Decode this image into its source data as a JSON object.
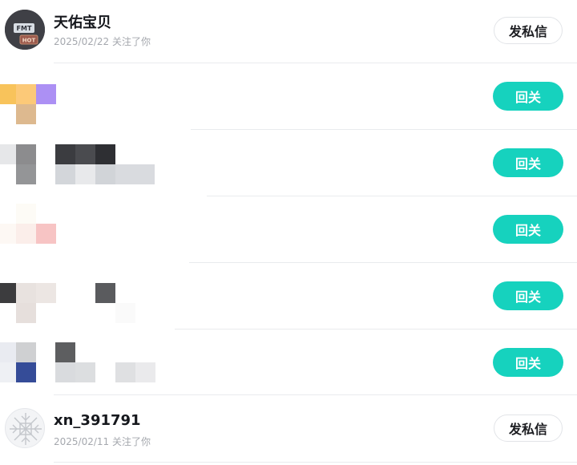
{
  "rows": [
    {
      "name": "天佑宝贝",
      "date": "2025/02/22",
      "action_text": "关注了你",
      "button_label": "发私信",
      "avatar_badge": "FMT",
      "avatar_badge_2": "HOT"
    },
    {
      "button_label": "回关"
    },
    {
      "button_label": "回关"
    },
    {
      "button_label": "回关"
    },
    {
      "button_label": "回关"
    },
    {
      "button_label": "回关"
    },
    {
      "name": "xn_391791",
      "date": "2025/02/11",
      "action_text": "关注了你",
      "button_label": "发私信"
    }
  ],
  "colors": {
    "accent": "#16d2be",
    "divider": "#e9ebee",
    "muted_text": "#a5a8ae"
  }
}
